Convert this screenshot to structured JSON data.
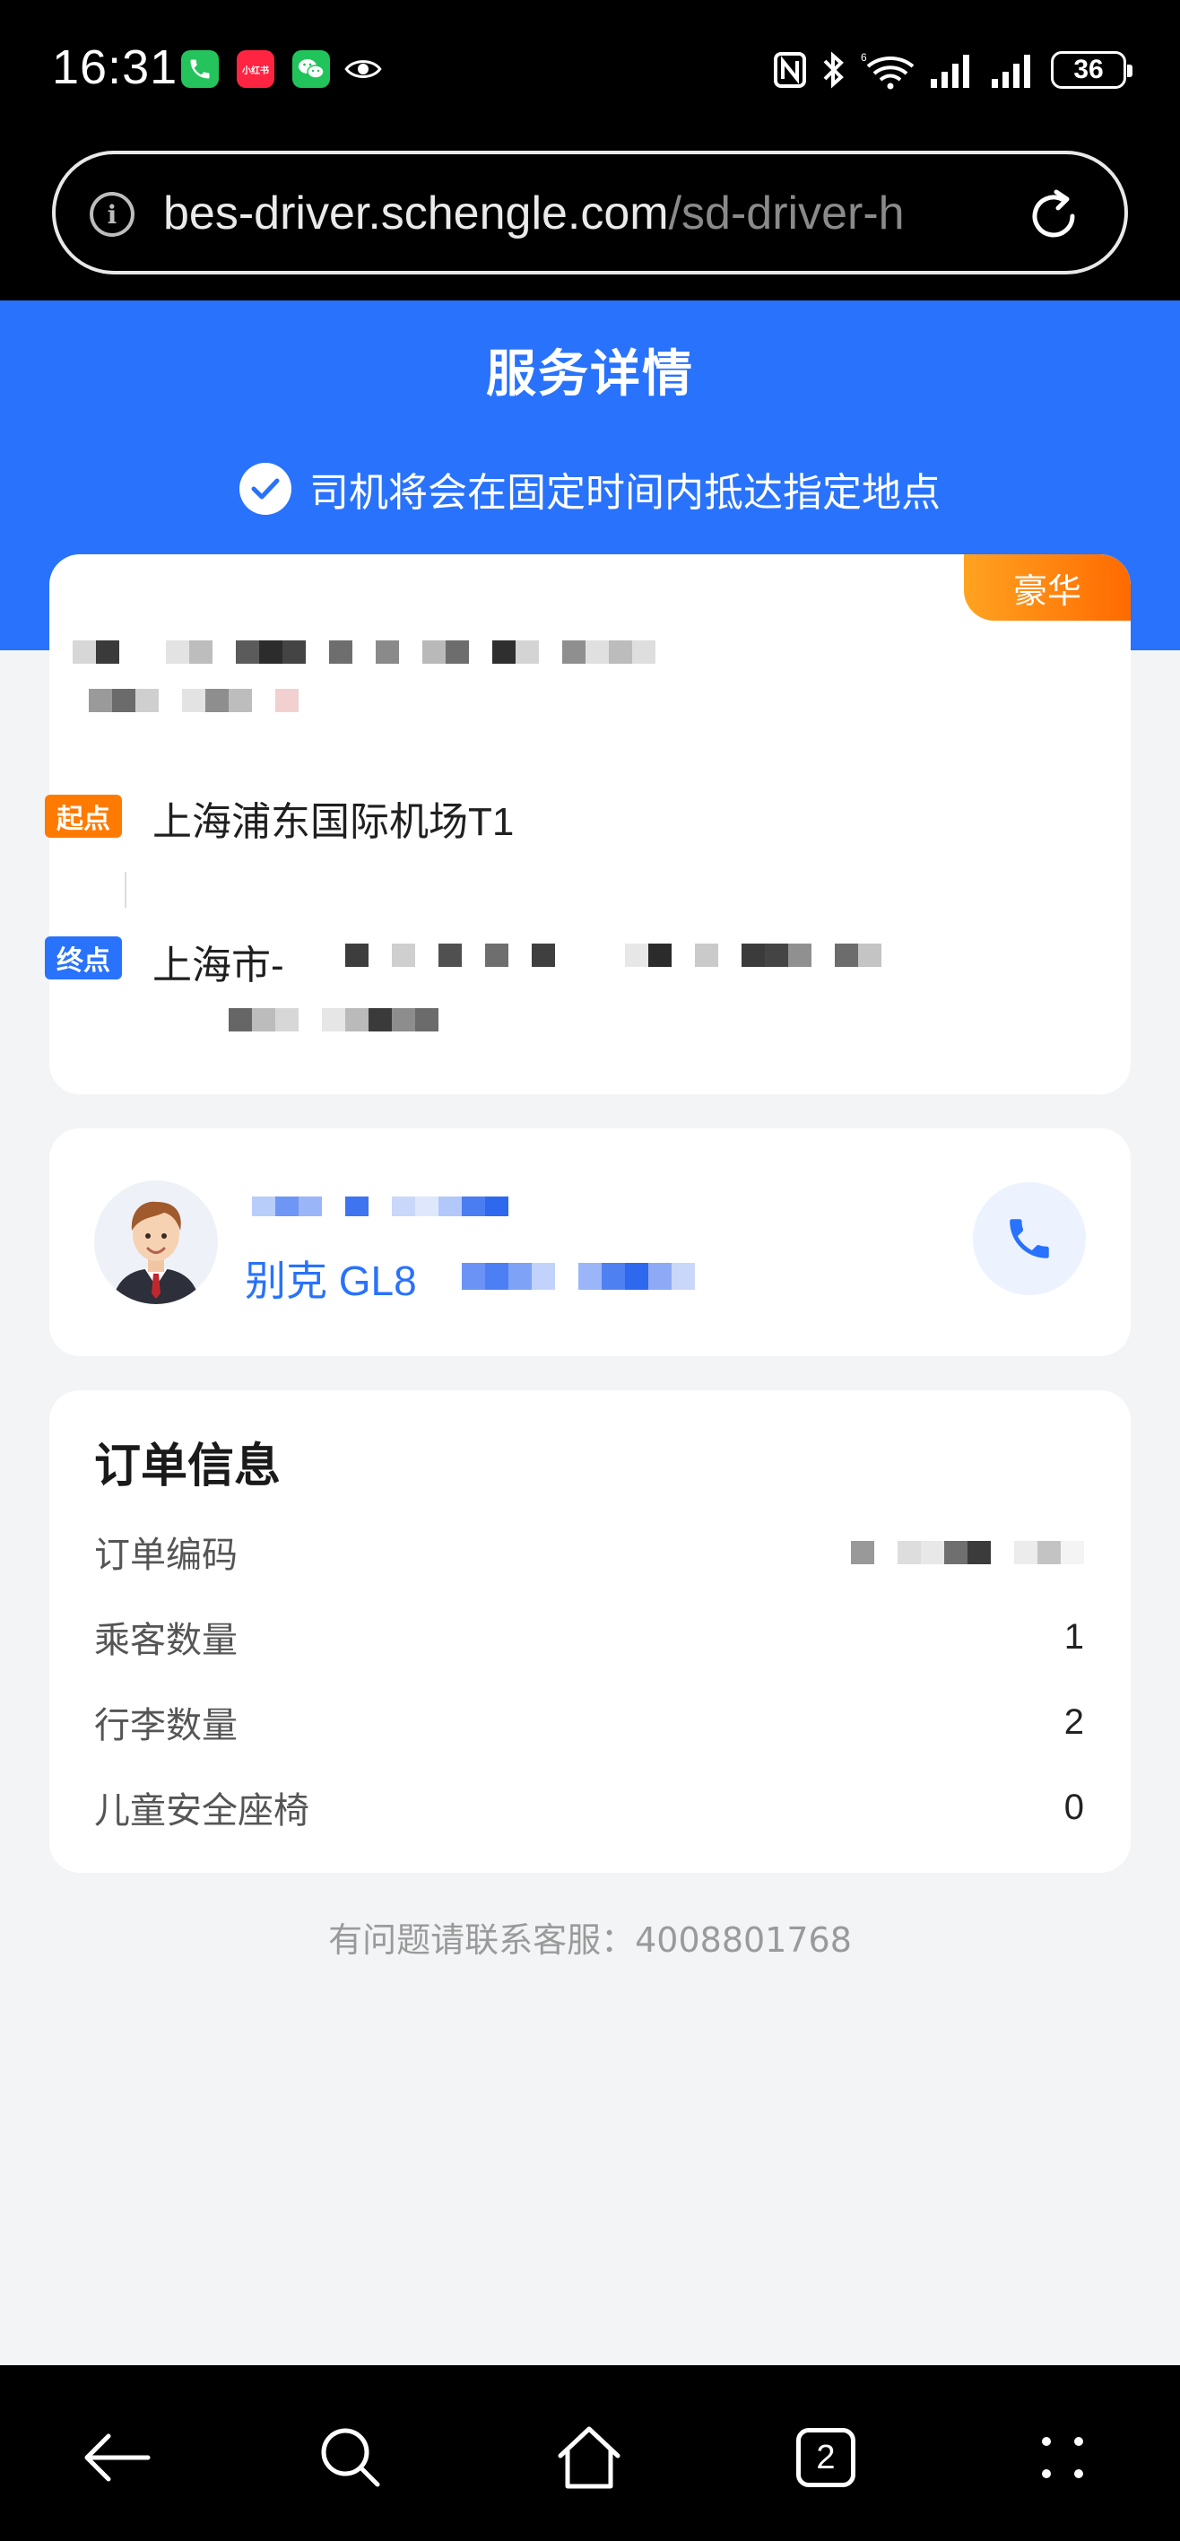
{
  "status_bar": {
    "time": "16:31",
    "notification_icons": [
      "phone-app-icon",
      "xiaohongshu-app-icon",
      "wechat-app-icon",
      "eye-icon"
    ],
    "xhs_label": "小红书",
    "right_icons": [
      "nfc-icon",
      "bluetooth-icon",
      "wifi-icon",
      "signal-icon",
      "signal-icon"
    ],
    "battery": "36"
  },
  "browser": {
    "url_main": "bes-driver.schengle.com",
    "url_rest": "/sd-driver-h"
  },
  "header": {
    "title": "服务详情",
    "subtitle": "司机将会在固定时间内抵达指定地点",
    "accent": "#2972fb"
  },
  "route": {
    "tier": "豪华",
    "start_tag": "起点",
    "start_address": "上海浦东国际机场T1",
    "end_tag": "终点",
    "end_address": "上海市-"
  },
  "driver": {
    "car_model": "别克 GL8"
  },
  "order": {
    "title": "订单信息",
    "rows": [
      {
        "label": "订单编码",
        "value": ""
      },
      {
        "label": "乘客数量",
        "value": "1"
      },
      {
        "label": "行李数量",
        "value": "2"
      },
      {
        "label": "儿童安全座椅",
        "value": "0"
      }
    ]
  },
  "footer": {
    "contact": "有问题请联系客服：4008801768"
  },
  "bottom_nav": {
    "tab_count": "2"
  }
}
